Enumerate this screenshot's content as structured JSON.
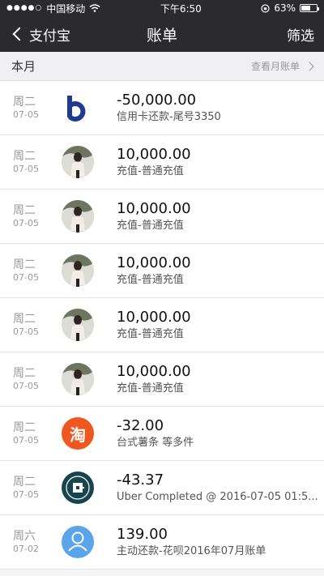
{
  "statusbar": {
    "signal": "●●●●○",
    "carrier": "中国移动",
    "time": "下午6:50",
    "battery_text": "63%",
    "battery_level": 0.63
  },
  "navbar": {
    "back_label": "支付宝",
    "title": "账单",
    "filter_label": "筛选"
  },
  "section": {
    "title": "本月",
    "link": "查看月账单"
  },
  "colors": {
    "header_bg": "#2b2b2f",
    "taobao": "#f0561f",
    "uber": "#17454e",
    "user": "#5aa4ec",
    "bank": "#1f3a8f"
  },
  "transactions": [
    {
      "weekday": "周二",
      "date": "07-05",
      "amount": "-50,000.00",
      "desc": "信用卡还款-尾号3350",
      "icon": "bank-logo-icon"
    },
    {
      "weekday": "周二",
      "date": "07-05",
      "amount": "10,000.00",
      "desc": "充值-普通充值",
      "icon": "avatar-photo-icon"
    },
    {
      "weekday": "周二",
      "date": "07-05",
      "amount": "10,000.00",
      "desc": "充值-普通充值",
      "icon": "avatar-photo-icon"
    },
    {
      "weekday": "周二",
      "date": "07-05",
      "amount": "10,000.00",
      "desc": "充值-普通充值",
      "icon": "avatar-photo-icon"
    },
    {
      "weekday": "周二",
      "date": "07-05",
      "amount": "10,000.00",
      "desc": "充值-普通充值",
      "icon": "avatar-photo-icon"
    },
    {
      "weekday": "周二",
      "date": "07-05",
      "amount": "10,000.00",
      "desc": "充值-普通充值",
      "icon": "avatar-photo-icon"
    },
    {
      "weekday": "周二",
      "date": "07-05",
      "amount": "-32.00",
      "desc": "台式薯条 等多件",
      "icon": "taobao-icon",
      "icon_glyph": "淘"
    },
    {
      "weekday": "周二",
      "date": "07-05",
      "amount": "-43.37",
      "desc": "Uber Completed @ 2016-07-05 01:5...",
      "icon": "uber-icon"
    },
    {
      "weekday": "周六",
      "date": "07-02",
      "amount": "139.00",
      "desc": "主动还款-花呗2016年07月账单",
      "icon": "user-icon"
    }
  ]
}
